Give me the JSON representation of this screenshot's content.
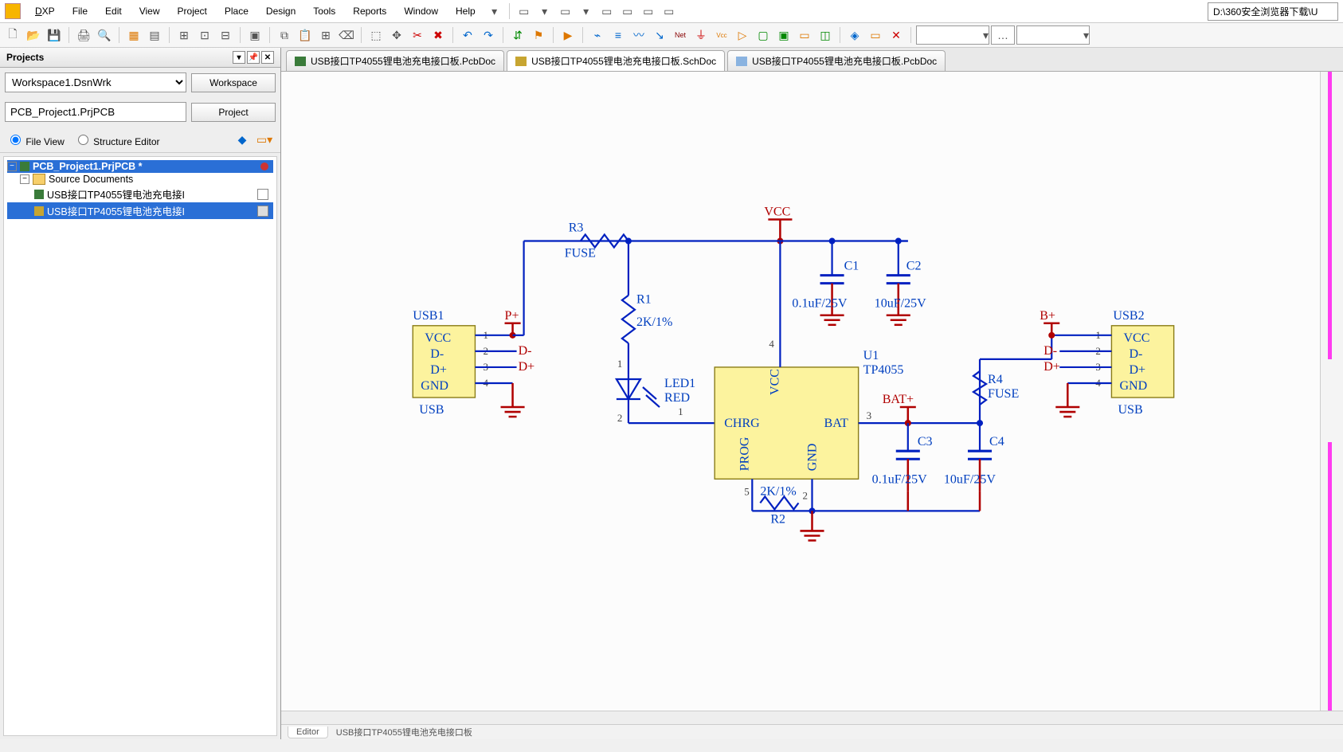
{
  "menu": {
    "dxp": "DXP",
    "file": "File",
    "edit": "Edit",
    "view": "View",
    "project": "Project",
    "place": "Place",
    "design": "Design",
    "tools": "Tools",
    "reports": "Reports",
    "window": "Window",
    "help": "Help"
  },
  "path_field": "D:\\360安全浏览器下载\\U",
  "panel": {
    "title": "Projects",
    "workspace_value": "Workspace1.DsnWrk",
    "workspace_btn": "Workspace",
    "project_value": "PCB_Project1.PrjPCB",
    "project_btn": "Project",
    "view_file": "File View",
    "view_struct": "Structure Editor"
  },
  "tree": {
    "root": "PCB_Project1.PrjPCB *",
    "folder": "Source Documents",
    "file1": "USB接口TP4055锂电池充电接I",
    "file2": "USB接口TP4055锂电池充电接I"
  },
  "tabs": {
    "t1": "USB接口TP4055锂电池充电接口板.PcbDoc",
    "t2": "USB接口TP4055锂电池充电接口板.SchDoc",
    "t3": "USB接口TP4055锂电池充电接口板.PcbDoc"
  },
  "bottom_tabs": {
    "editor": "Editor",
    "doc": "USB接口TP4055锂电池充电接口板"
  },
  "sch": {
    "vcc": "VCC",
    "usb1": "USB1",
    "usb2": "USB2",
    "usb": "USB",
    "pplus": "P+",
    "bplus": "B+",
    "dminus": "D-",
    "dplus": "D+",
    "p_vcc": "VCC",
    "p_dm": "D-",
    "p_dp": "D+",
    "p_gnd": "GND",
    "r1": "R1",
    "r1v": "2K/1%",
    "r2": "R2",
    "r2v": "2K/1%",
    "r3": "R3",
    "r3v": "FUSE",
    "r4": "R4",
    "r4v": "FUSE",
    "c1": "C1",
    "c2": "C2",
    "c3": "C3",
    "c4": "C4",
    "c1v": "0.1uF/25V",
    "c2v": "10uF/25V",
    "c3v": "0.1uF/25V",
    "c4v": "10uF/25V",
    "u1": "U1",
    "u1v": "TP4055",
    "led1": "LED1",
    "led1v": "RED",
    "chrg": "CHRG",
    "bat": "BAT",
    "batp": "BAT+",
    "gnd": "GND",
    "prog": "PROG",
    "icvcc": "VCC",
    "n1": "1",
    "n2": "2",
    "n3": "3",
    "n4": "4",
    "n5": "5"
  }
}
